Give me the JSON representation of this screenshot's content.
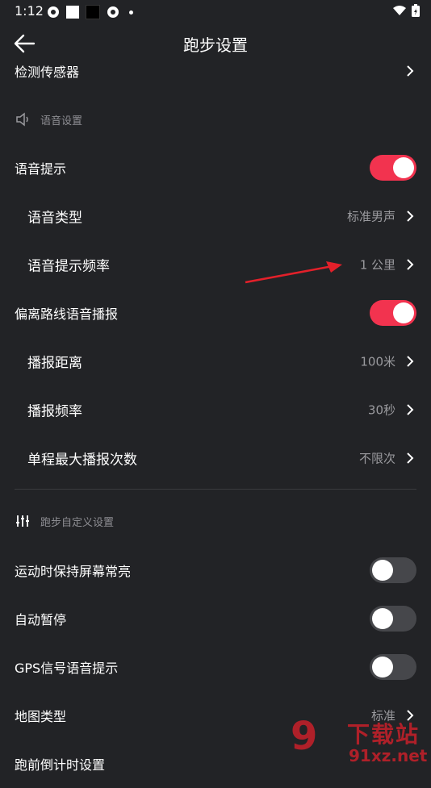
{
  "status": {
    "time": "1:12"
  },
  "header": {
    "title": "跑步设置"
  },
  "rows": {
    "sensor": {
      "label": "检测传感器"
    },
    "voice_prompt": {
      "label": "语音提示",
      "on": true
    },
    "voice_type": {
      "label": "语音类型",
      "value": "标准男声"
    },
    "voice_freq": {
      "label": "语音提示频率",
      "value": "1 公里"
    },
    "deviate_voice": {
      "label": "偏离路线语音播报",
      "on": true
    },
    "report_distance": {
      "label": "播报距离",
      "value": "100米"
    },
    "report_freq": {
      "label": "播报频率",
      "value": "30秒"
    },
    "max_reports": {
      "label": "单程最大播报次数",
      "value": "不限次"
    },
    "keep_screen": {
      "label": "运动时保持屏幕常亮",
      "on": false
    },
    "auto_pause": {
      "label": "自动暂停",
      "on": false
    },
    "gps_voice": {
      "label": "GPS信号语音提示",
      "on": false
    },
    "map_type": {
      "label": "地图类型",
      "value": "标准"
    },
    "countdown": {
      "label": "跑前倒计时设置"
    }
  },
  "sections": {
    "voice": "语音设置",
    "custom": "跑步自定义设置"
  },
  "watermark": {
    "big": "9",
    "sub": "下载站",
    "url": "91xz.net"
  },
  "colors": {
    "background": "#222326",
    "accent": "#f2334f",
    "muted": "#9a9a9e"
  }
}
